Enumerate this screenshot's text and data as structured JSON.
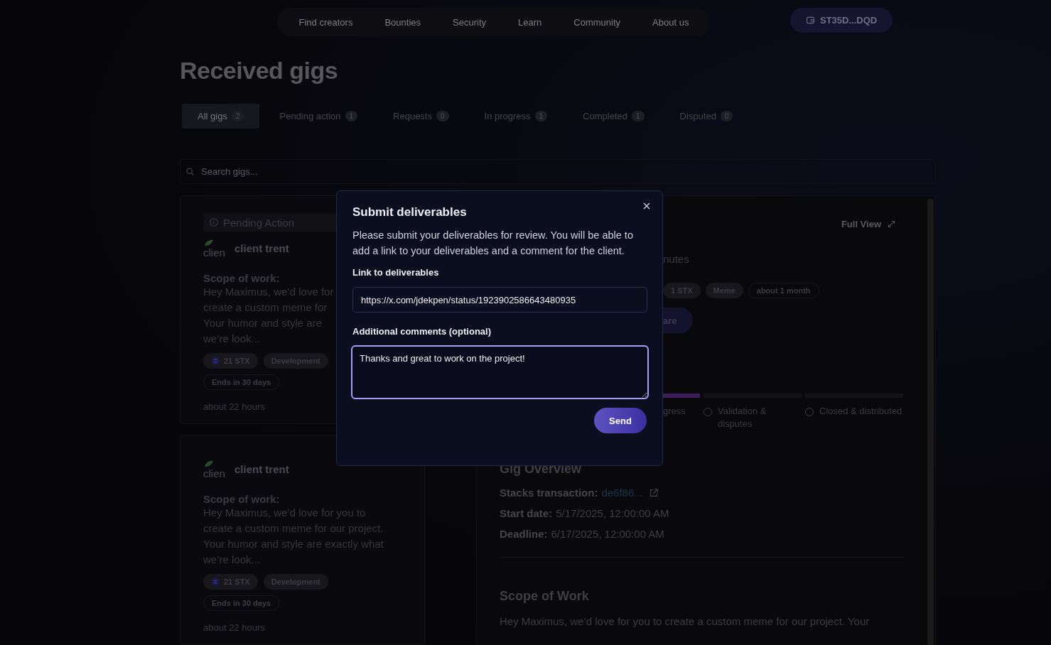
{
  "nav": {
    "links": [
      "Find creators",
      "Bounties",
      "Security",
      "Learn",
      "Community",
      "About us"
    ],
    "wallet": "ST35D...DQD"
  },
  "title": "Received gigs",
  "tabs": [
    {
      "label": "All gigs",
      "count": "2",
      "selected": true
    },
    {
      "label": "Pending action",
      "count": "1",
      "selected": false
    },
    {
      "label": "Requests",
      "count": "0",
      "selected": false
    },
    {
      "label": "In progress",
      "count": "1",
      "selected": false
    },
    {
      "label": "Completed",
      "count": "1",
      "selected": false
    },
    {
      "label": "Disputed",
      "count": "0",
      "selected": false
    }
  ],
  "search": {
    "placeholder": "Search gigs..."
  },
  "gigs": [
    {
      "status": "Pending Action",
      "avatar_alt": "clien",
      "client": "client trent",
      "scope_label": "Scope of work:",
      "scope_lines": [
        "Hey Maximus, we’d love for",
        "create a custom meme for",
        "Your humor and style are",
        "we’re look..."
      ],
      "amount": "21 STX",
      "category": "Development",
      "ends": "Ends in 30 days",
      "age": "about 22 hours"
    },
    {
      "avatar_alt": "clien",
      "client": "client trent",
      "scope_label": "Scope of work:",
      "scope_lines": [
        "Hey Maximus, we’d love for you to",
        "create a custom meme for our project.",
        "Your humor and style are exactly what",
        "we’re look..."
      ],
      "amount": "21 STX",
      "category": "Development",
      "ends": "Ends in 30 days",
      "age": "about 22 hours"
    }
  ],
  "detail": {
    "full_view": "Full View",
    "status_text": "nutes",
    "tags": [
      {
        "label": "1 STX",
        "kind": "filled"
      },
      {
        "label": "Meme",
        "kind": "filled"
      },
      {
        "label": "about 1 month",
        "kind": "outline"
      }
    ],
    "share": "are",
    "steps": [
      {
        "label": "gress",
        "reached": true
      },
      {
        "label": "Validation & disputes",
        "reached": false
      },
      {
        "label": "Closed & distributed",
        "reached": false
      }
    ],
    "overview_title": "Gig Overview",
    "rows": [
      {
        "label": "Stacks transaction:",
        "value": "de6f86...",
        "kind": "link"
      },
      {
        "label": "Start date:",
        "value": "5/17/2025, 12:00:00 AM",
        "kind": "text"
      },
      {
        "label": "Deadline:",
        "value": "6/17/2025, 12:00:00 AM",
        "kind": "text"
      }
    ],
    "scope_title": "Scope of Work",
    "scope_text": "Hey Maximus, we’d love for you to create a custom meme for our project. Your"
  },
  "modal": {
    "title": "Submit deliverables",
    "description": "Please submit your deliverables for review. You will be able to add a link to your deliverables and a comment for the client.",
    "link_label": "Link to deliverables",
    "link_value": "https://x.com/jdekpen/status/1923902586643480935",
    "comments_label": "Additional comments (optional)",
    "comments_value": "Thanks and great to work on the project!",
    "send": "Send"
  }
}
